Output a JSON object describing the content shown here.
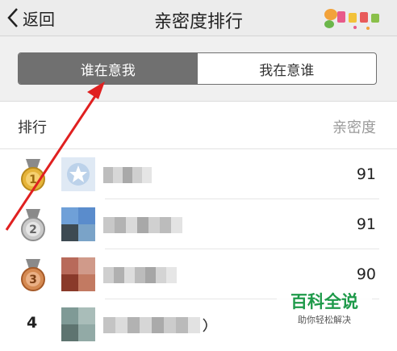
{
  "header": {
    "back_label": "返回",
    "title": "亲密度排行"
  },
  "tabs": {
    "active": "谁在意我",
    "inactive": "我在意谁"
  },
  "list_header": {
    "left": "排行",
    "right": "亲密度"
  },
  "rows": [
    {
      "rank": "1",
      "score": "91",
      "medal": "gold"
    },
    {
      "rank": "2",
      "score": "91",
      "medal": "silver"
    },
    {
      "rank": "3",
      "score": "90",
      "medal": "bronze"
    },
    {
      "rank": "4",
      "score": ""
    }
  ],
  "watermark": {
    "title": "百科全说",
    "subtitle": "助你轻松解决"
  },
  "colors": {
    "tab_active": "#707070",
    "arrow": "#e02020",
    "watermark_green": "#1e9a4a"
  }
}
